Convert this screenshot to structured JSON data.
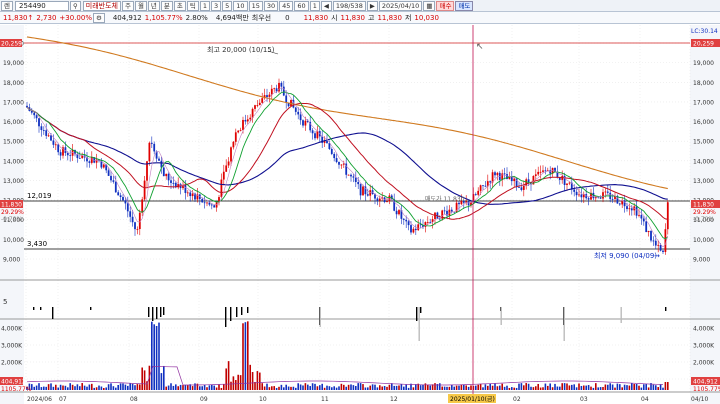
{
  "toolbar": {
    "code_prefix": "렌",
    "code": "254490",
    "name": "미래반도체",
    "periods": [
      "주",
      "월",
      "년",
      "분",
      "초",
      "틱"
    ],
    "intervals": [
      "1",
      "3",
      "5",
      "10",
      "15",
      "30",
      "45",
      "60",
      "1"
    ],
    "page_counter": "198/538",
    "date": "2025/04/10",
    "buy_label": "매수",
    "sell_label": "매도",
    "price": "11,830",
    "change": "2,730",
    "change_pct": "+30.00%",
    "volume": "404,912",
    "volume_ratio": "1,105.77%",
    "turnover": "2.80%",
    "amount": "4,694백만",
    "priority_label": "최우선",
    "priority_value": "0",
    "open_price": "11,830",
    "open_label": "시",
    "high_price": "11,830",
    "high_label": "고",
    "high_price2": "11,830",
    "low_label": "저",
    "low_price": "10,030"
  },
  "chart": {
    "high_annotation": "최고 20,000 (10/15)",
    "low_annotation": "최저 9,090 (04/09)",
    "hline_top_value": "20,259",
    "hline_mid_value": "12,019",
    "hline_low_value": "3,430",
    "cursor_date": "2025/01/10(금)",
    "lc_label": "LC:30.14",
    "mid_label": "매도가 11,830",
    "price_tag": "11,830",
    "pct_tag": "29.29%",
    "pct_tag2": "-0.79%",
    "vol_tag": "404,912",
    "vol_pct_tag": "1105.77%",
    "sub_label": "5",
    "y_ticks": [
      "20,000",
      "19,000",
      "18,000",
      "17,000",
      "16,000",
      "15,000",
      "14,000",
      "13,000",
      "12,000",
      "11,000",
      "10,000",
      "9,000"
    ],
    "vol_ticks": [
      "4,000K",
      "3,000K",
      "2,000K",
      "1,000K"
    ],
    "x_ticks": [
      "2024/06",
      "07",
      "08",
      "09",
      "10",
      "11",
      "12",
      "02",
      "03",
      "04",
      "04/10"
    ],
    "colors": {
      "up": "#e00000",
      "down": "#1030c0",
      "ma_orange": "#d07a20",
      "ma_navy": "#101090",
      "ma_red": "#c01020",
      "ma_green": "#10a030"
    }
  }
}
